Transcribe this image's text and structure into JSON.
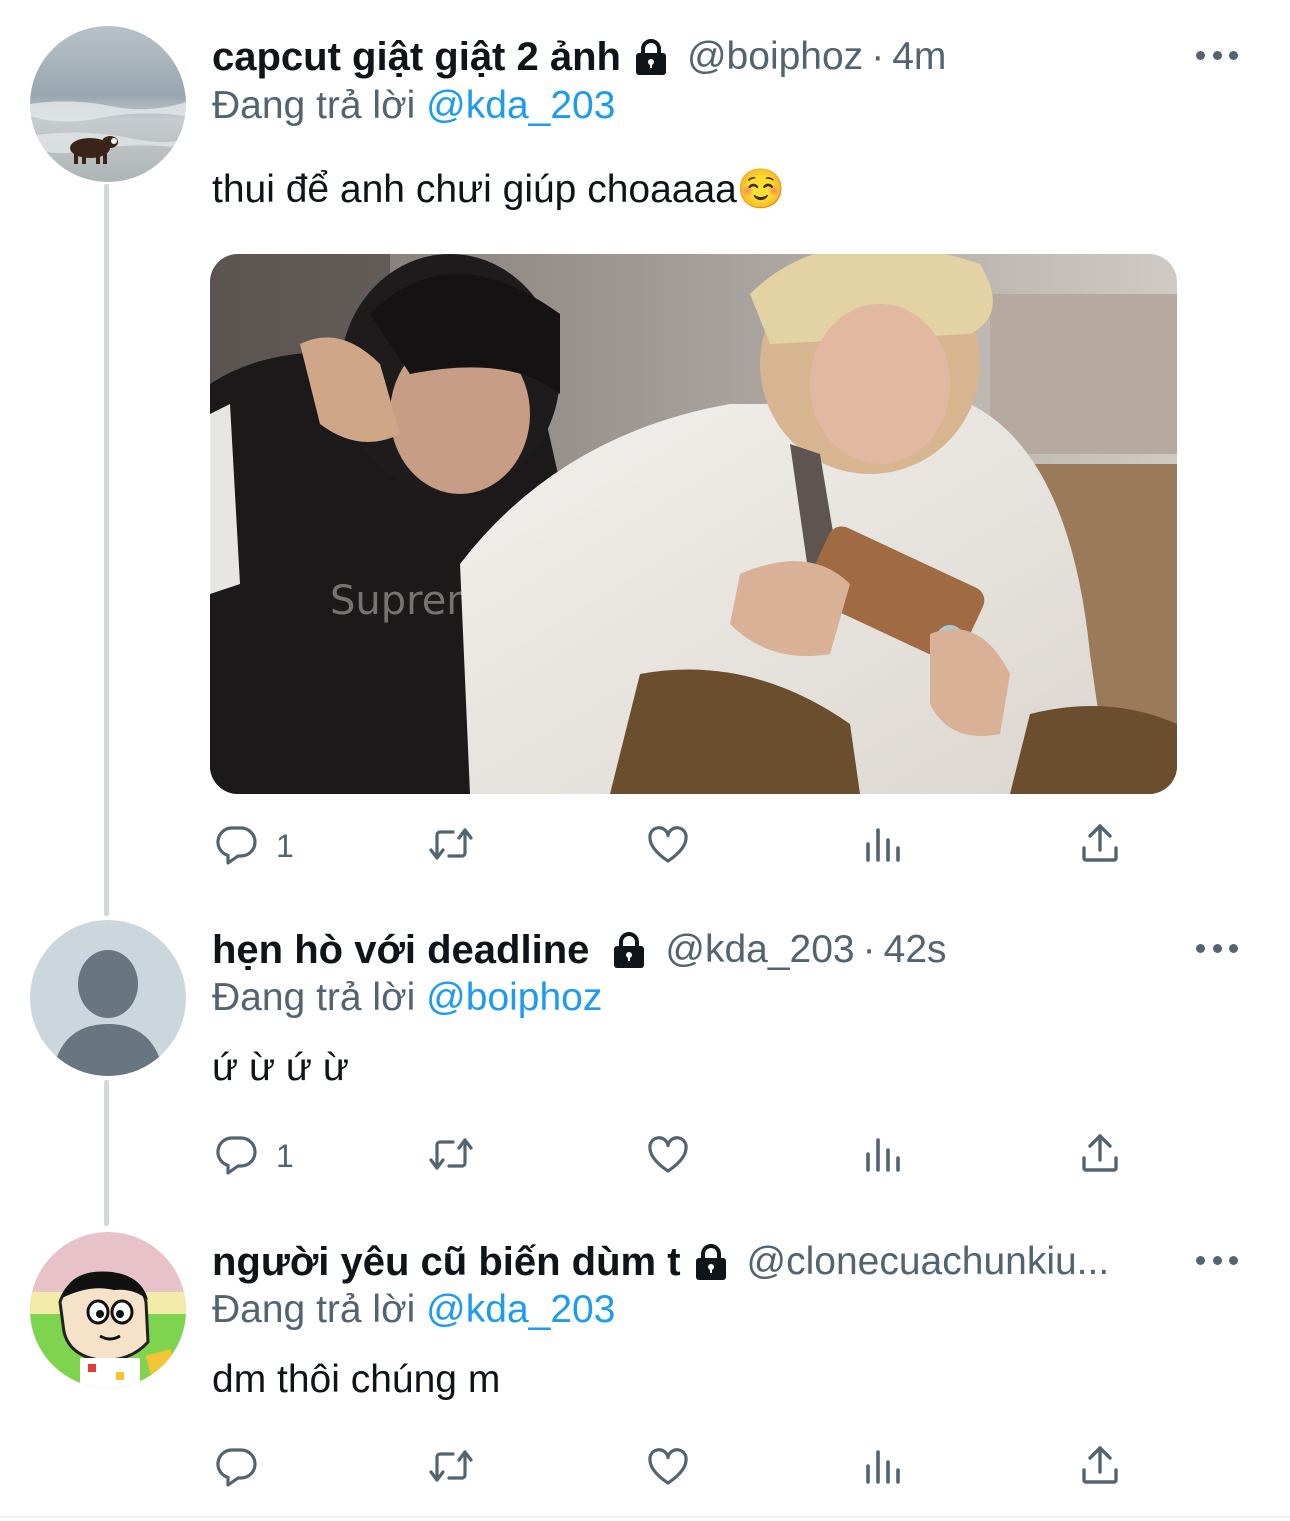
{
  "colors": {
    "text": "#0f1419",
    "secondary": "#536471",
    "mention_blue": "#1d9bf0",
    "thread_line": "#cfd9de"
  },
  "tweets": [
    {
      "display_name": "capcut giật giật 2 ảnh",
      "protected_icon": "lock-icon",
      "handle": "@boiphoz",
      "separator": "·",
      "time": "4m",
      "reply_prefix": "Đang trả lời",
      "reply_to": "@kda_203",
      "text": "thui để anh chưi giúp choaaaa☺️",
      "has_media": true,
      "avatar": "cow-on-beach-photo",
      "actions": {
        "reply_count": "1",
        "retweet_count": "",
        "like_count": ""
      }
    },
    {
      "display_name": "hẹn hò với deadline",
      "protected_icon": "lock-icon",
      "handle": "@kda_203",
      "separator": "·",
      "time": "42s",
      "reply_prefix": "Đang trả lời",
      "reply_to": "@boiphoz",
      "text": "ứ ừ ứ ừ",
      "has_media": false,
      "avatar": "default-profile-avatar",
      "actions": {
        "reply_count": "1",
        "retweet_count": "",
        "like_count": ""
      }
    },
    {
      "display_name": "người yêu cũ biến dùm t",
      "protected_icon": "lock-icon",
      "handle": "@clonecuachunkiu...",
      "separator": "",
      "time": "",
      "reply_prefix": "Đang trả lời",
      "reply_to": "@kda_203",
      "text": "dm thôi chúng m",
      "has_media": false,
      "avatar": "cartoon-character-avatar",
      "actions": {
        "reply_count": "",
        "retweet_count": "",
        "like_count": ""
      }
    }
  ]
}
